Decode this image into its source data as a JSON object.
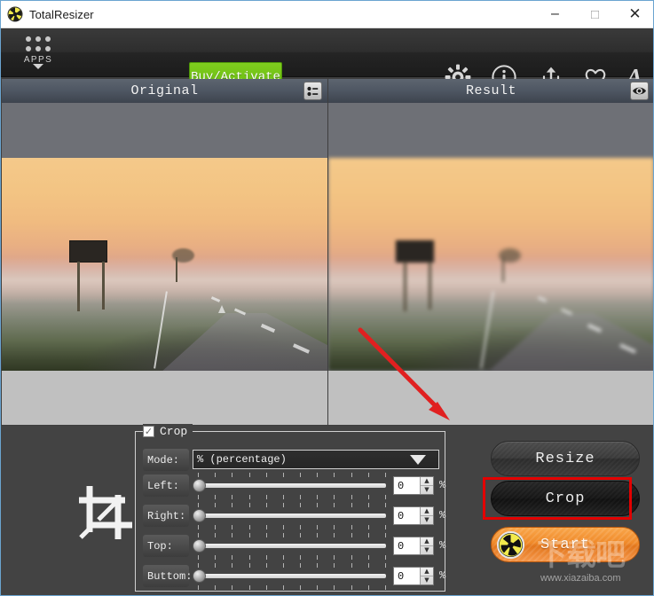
{
  "window": {
    "title": "TotalResizer",
    "app_icon": "radiation-app-icon",
    "controls": {
      "minimize": "–",
      "maximize": "□",
      "close": "✕"
    }
  },
  "toolbar": {
    "apps_label": "APPS",
    "apps_icon": "grid-dots-icon",
    "apps_caret_icon": "chevron-down-icon",
    "buy_label": "Buy/Activate",
    "buy_color": "#6ebd12",
    "icons": [
      {
        "name": "gear-icon",
        "glyph": "⚙"
      },
      {
        "name": "info-icon",
        "glyph": "ⓘ"
      },
      {
        "name": "share-icon",
        "glyph": "⇧"
      },
      {
        "name": "heart-icon",
        "glyph": "♡"
      },
      {
        "name": "font-icon",
        "glyph": "A"
      }
    ]
  },
  "panels": {
    "original": {
      "title": "Original",
      "header_icon": "list-view-icon"
    },
    "result": {
      "title": "Result",
      "header_icon": "eye-preview-icon"
    }
  },
  "crop_panel": {
    "legend": "Crop",
    "checked": true,
    "tool_icon": "crop-tool-icon",
    "mode": {
      "label": "Mode:",
      "value": "% (percentage)",
      "caret_icon": "caret-down-icon"
    },
    "sliders": [
      {
        "label": "Left:",
        "value": "0",
        "unit": "%",
        "position": 0
      },
      {
        "label": "Right:",
        "value": "0",
        "unit": "%",
        "position": 0
      },
      {
        "label": "Top:",
        "value": "0",
        "unit": "%",
        "position": 0
      },
      {
        "label": "Buttom:",
        "value": "0",
        "unit": "%",
        "position": 0
      }
    ],
    "spinner_up": "▲",
    "spinner_down": "▼",
    "tick_count": 12
  },
  "actions": {
    "resize_label": "Resize",
    "crop_label": "Crop",
    "start_label": "Start",
    "start_badge_icon": "radiation-icon",
    "highlight_color": "#e30000",
    "highlight_target": "Crop"
  },
  "annotation": {
    "arrow_color": "#e02020",
    "arrow_from": "405,256",
    "arrow_to": "505,355"
  },
  "watermark": {
    "text_cn": "下载吧",
    "url": "www.xiazaiba.com"
  }
}
